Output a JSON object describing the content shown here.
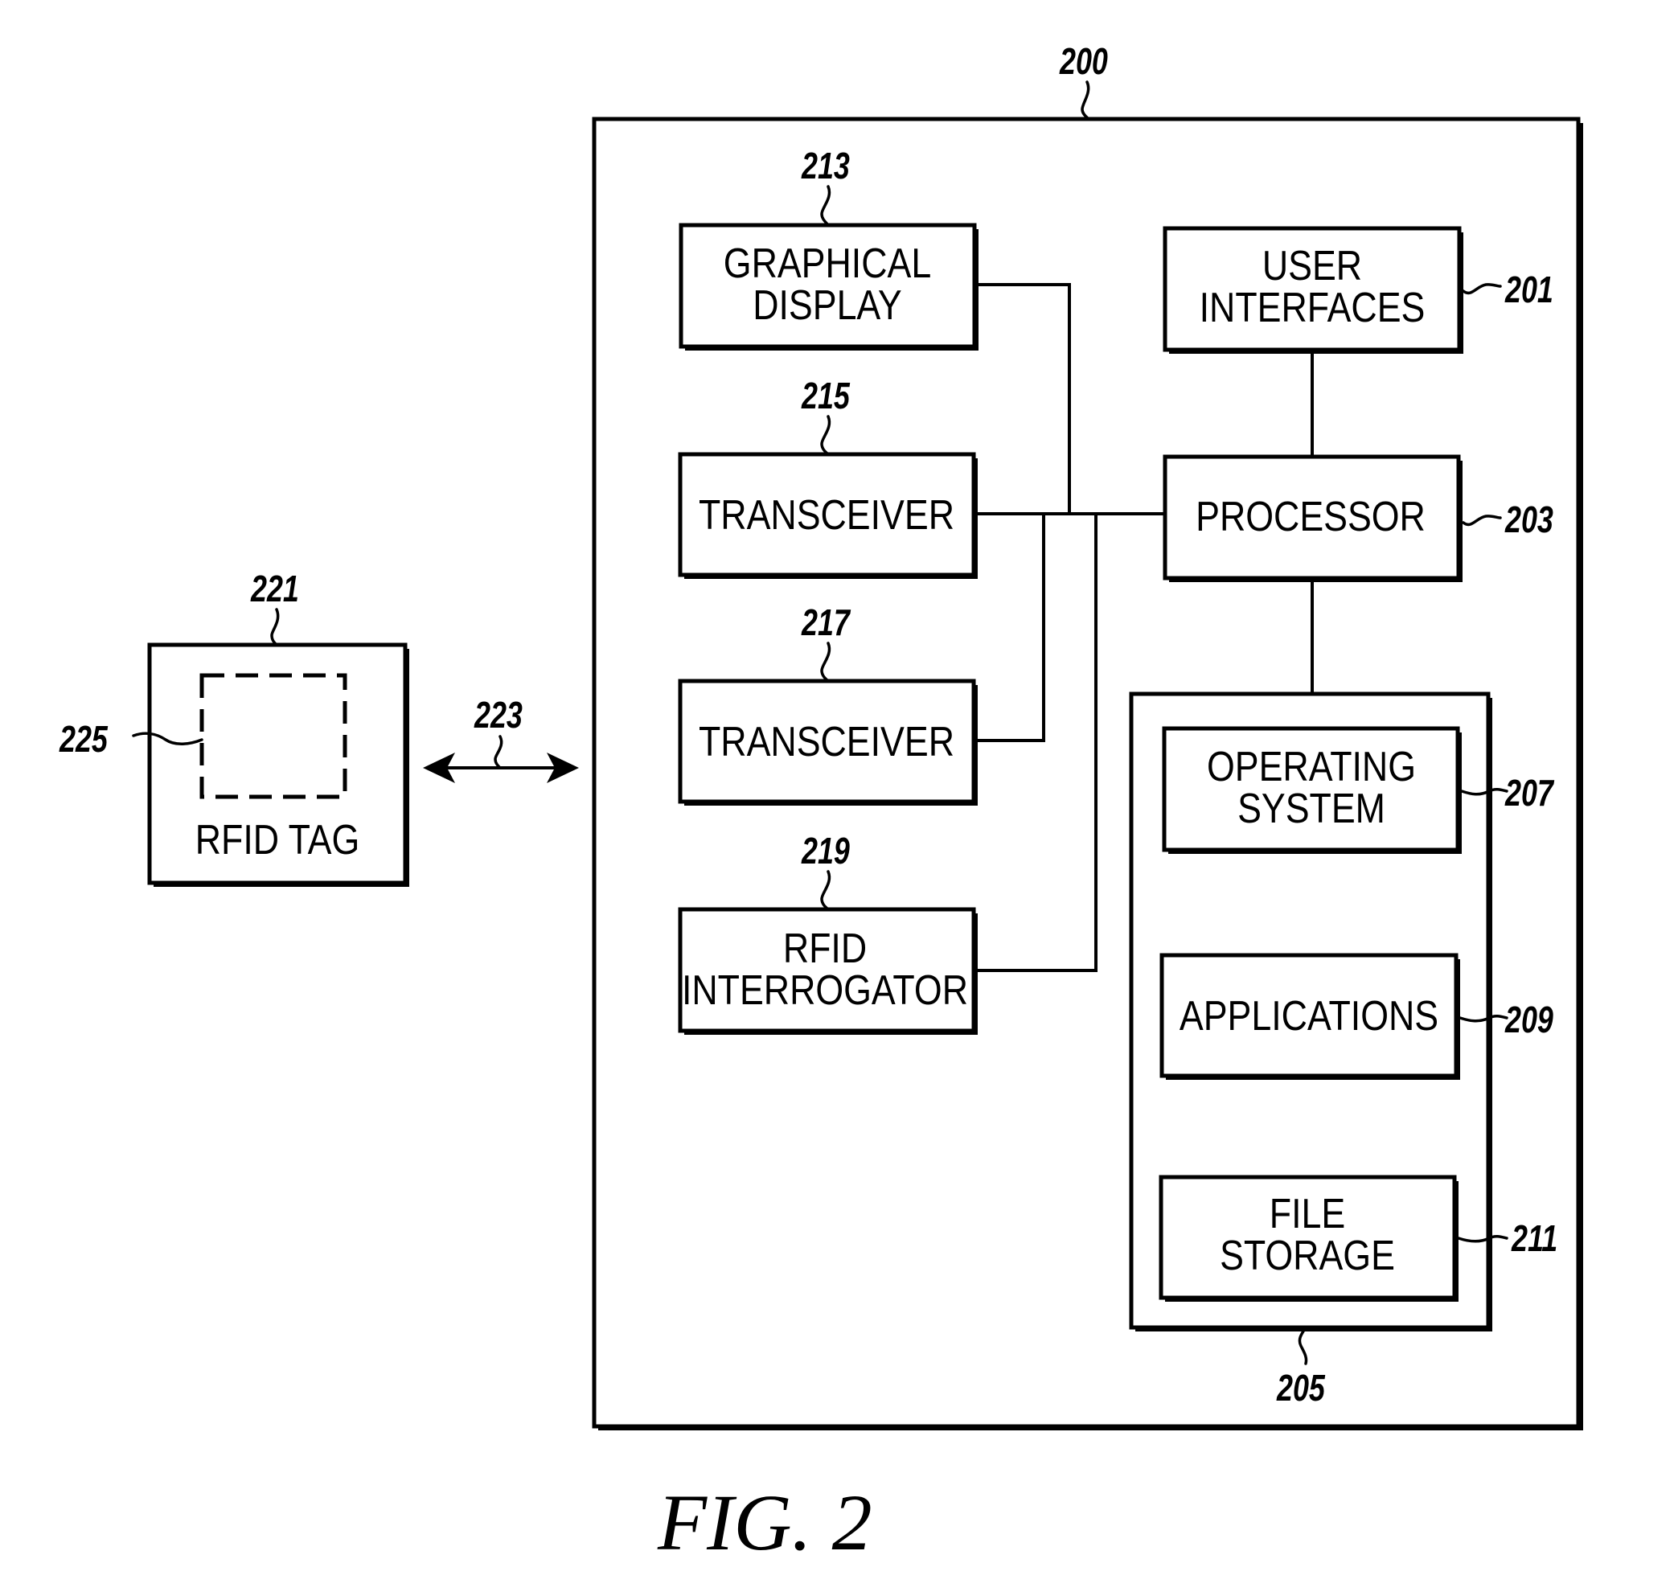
{
  "figure": {
    "caption": "FIG. 2",
    "device": {
      "ref": "200",
      "blocks": [
        {
          "id": "graphical-display",
          "ref": "213",
          "lines": [
            "GRAPHICAL",
            "DISPLAY"
          ]
        },
        {
          "id": "transceiver-1",
          "ref": "215",
          "lines": [
            "TRANSCEIVER"
          ]
        },
        {
          "id": "transceiver-2",
          "ref": "217",
          "lines": [
            "TRANSCEIVER"
          ]
        },
        {
          "id": "rfid-interrogator",
          "ref": "219",
          "lines": [
            "RFID",
            "INTERROGATOR"
          ]
        },
        {
          "id": "user-interfaces",
          "ref": "201",
          "lines": [
            "USER",
            "INTERFACES"
          ]
        },
        {
          "id": "processor",
          "ref": "203",
          "lines": [
            "PROCESSOR"
          ]
        }
      ],
      "memory": {
        "ref": "205",
        "blocks": [
          {
            "id": "operating-system",
            "ref": "207",
            "lines": [
              "OPERATING",
              "SYSTEM"
            ]
          },
          {
            "id": "applications",
            "ref": "209",
            "lines": [
              "APPLICATIONS"
            ]
          },
          {
            "id": "file-storage",
            "ref": "211",
            "lines": [
              "FILE",
              "STORAGE"
            ]
          }
        ]
      }
    },
    "tag": {
      "ref": "221",
      "label": "RFID TAG",
      "inner_ref": "225"
    },
    "link": {
      "ref": "223",
      "direction": "bidirectional"
    }
  }
}
